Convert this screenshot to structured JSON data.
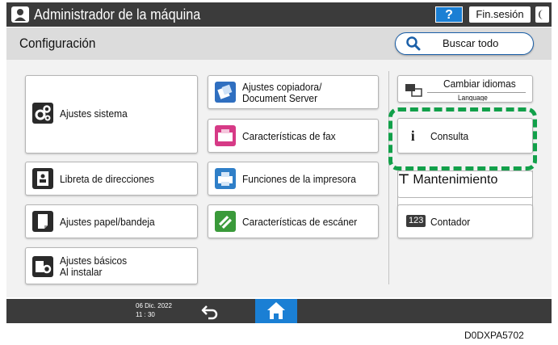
{
  "titlebar": {
    "title": "Administrador de la máquina",
    "help_label": "?",
    "logout_label": "Fin.sesión",
    "user_icon": "user-icon",
    "moon_icon": "moon-icon"
  },
  "header": {
    "page_title": "Configuración",
    "search_label": "Buscar todo"
  },
  "menu": {
    "system_settings": "Ajustes sistema",
    "address_book": "Libreta de direcciones",
    "tray_paper": "Ajustes papel/bandeja",
    "basic_settings": "Ajustes básicos\nAl instalar",
    "copier": "Ajustes copiadora/\nDocument Server",
    "fax": "Características de fax",
    "printer": "Funciones de la impresora",
    "scanner": "Características de escáner",
    "change_language": "Cambiar idiomas",
    "change_language_sub": "Language",
    "inquiry": "Consulta",
    "maintenance": "Mantenimiento",
    "counter": "Contador",
    "counter_badge": "123"
  },
  "footer": {
    "date": "06 Dic. 2022",
    "time": "11 : 30"
  },
  "doc_code": "D0DXPA5702",
  "colors": {
    "accent_blue": "#1a7fd4",
    "highlight_green": "#12a04a",
    "bar_dark": "#3b3b3b"
  }
}
